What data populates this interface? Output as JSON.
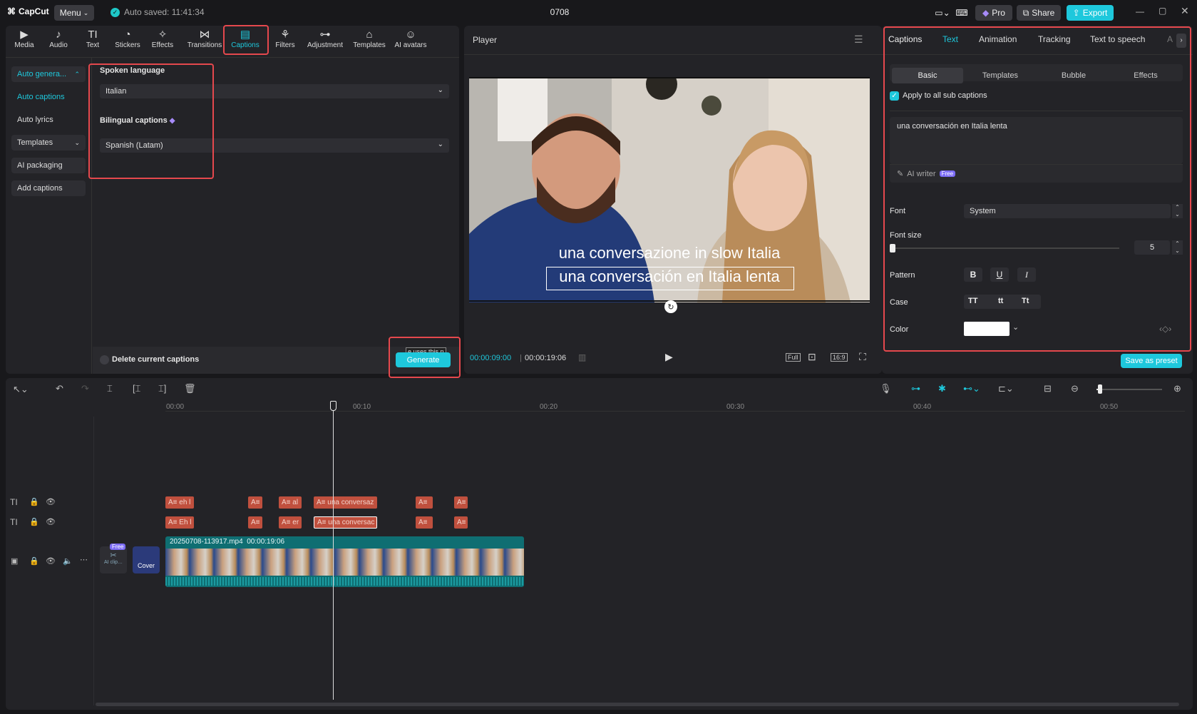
{
  "app": {
    "logo": "CapCut",
    "menu": "Menu",
    "autosave": "Auto saved: 11:41:34",
    "project_title": "0708",
    "pro": "Pro",
    "share": "Share",
    "export": "Export"
  },
  "toolbar": [
    {
      "label": "Media",
      "icon": "media-icon"
    },
    {
      "label": "Audio",
      "icon": "audio-icon"
    },
    {
      "label": "Text",
      "icon": "text-icon"
    },
    {
      "label": "Stickers",
      "icon": "stickers-icon"
    },
    {
      "label": "Effects",
      "icon": "effects-icon"
    },
    {
      "label": "Transitions",
      "icon": "transitions-icon"
    },
    {
      "label": "Captions",
      "icon": "captions-icon"
    },
    {
      "label": "Filters",
      "icon": "filters-icon"
    },
    {
      "label": "Adjustment",
      "icon": "adjustment-icon"
    },
    {
      "label": "Templates",
      "icon": "templates-icon"
    },
    {
      "label": "AI avatars",
      "icon": "ai-avatars-icon"
    }
  ],
  "left_nav": {
    "auto_generate": "Auto genera...",
    "auto_captions": "Auto captions",
    "auto_lyrics": "Auto lyrics",
    "templates": "Templates",
    "ai_packaging": "AI packaging",
    "add_captions": "Add captions"
  },
  "captions_panel": {
    "spoken_language_label": "Spoken language",
    "spoken_language": "Italian",
    "bilingual_label": "Bilingual captions",
    "bilingual_value": "Spanish (Latam)",
    "delete_current": "Delete current captions",
    "uses_tip": "e uses this n",
    "generate": "Generate"
  },
  "player": {
    "title": "Player",
    "caption_line1": "una conversazione in slow Italia",
    "caption_line2": "una conversación en Italia lenta",
    "current_time": "00:00:09:00",
    "total_time": "00:00:19:06",
    "full": "Full",
    "ratio": "16:9"
  },
  "right_panel": {
    "tabs": [
      "Captions",
      "Text",
      "Animation",
      "Tracking",
      "Text to speech",
      "A"
    ],
    "subtabs": [
      "Basic",
      "Templates",
      "Bubble",
      "Effects"
    ],
    "apply_all": "Apply to all sub captions",
    "text_value": "una conversación en Italia lenta",
    "ai_writer": "AI writer",
    "free_badge": "Free",
    "font_label": "Font",
    "font_value": "System",
    "font_size_label": "Font size",
    "font_size_value": "5",
    "pattern_label": "Pattern",
    "pattern_b": "B",
    "pattern_u": "U",
    "pattern_i": "I",
    "case_label": "Case",
    "case_upper": "TT",
    "case_lower": "tt",
    "case_title": "Tt",
    "color_label": "Color",
    "color_value": "#ffffff",
    "save_preset": "Save as preset"
  },
  "timeline": {
    "ruler": [
      "00:00",
      "00:10",
      "00:20",
      "00:30",
      "00:40",
      "00:50"
    ],
    "track1": [
      "A≡ eh l",
      "A≡",
      "A≡ al",
      "A≡ una conversaz",
      "A≡ ",
      "A≡"
    ],
    "track2": [
      "A≡ Eh l",
      "A≡",
      "A≡ er",
      "A≡ una conversac",
      "A≡ ",
      "A≡"
    ],
    "video_name": "20250708-113917.mp4",
    "video_duration": "00:00:19:06",
    "free_badge": "Free",
    "ai_clip": "AI clip…",
    "cover": "Cover"
  }
}
